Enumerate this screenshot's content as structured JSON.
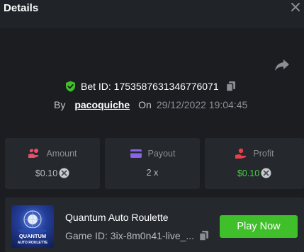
{
  "header": {
    "title": "Details"
  },
  "bet": {
    "id_label": "Bet ID: 1753587631346776071",
    "by_label": "By",
    "username": "pacoquiche",
    "on_label": "On",
    "datetime": "29/12/2022 19:04:45"
  },
  "stats": {
    "amount": {
      "label": "Amount",
      "value": "$0.10"
    },
    "payout": {
      "label": "Payout",
      "value": "2 x"
    },
    "profit": {
      "label": "Profit",
      "value": "$0.10"
    }
  },
  "game": {
    "name": "Quantum Auto Roulette",
    "id_text": "Game ID: 3ix-8m0n41-live_...",
    "thumb_line1": "QUANTUM",
    "thumb_line2": "AUTO ROULETTE",
    "play_label": "Play Now"
  },
  "colors": {
    "background": "#1b1d21",
    "card": "#25282d",
    "accent_green": "#3fbf2a",
    "profit_green": "#45d13d",
    "amount_icon": "#e8506a",
    "payout_icon": "#8a63e8",
    "profit_icon": "#e8404a"
  },
  "icons": {
    "close": "close-icon",
    "share": "share-arrow-icon",
    "verified": "shield-check-icon",
    "copy": "copy-icon",
    "amount": "hand-coins-icon",
    "payout": "wallet-card-icon",
    "profit": "hand-coin-icon",
    "coin": "coin-icon"
  }
}
